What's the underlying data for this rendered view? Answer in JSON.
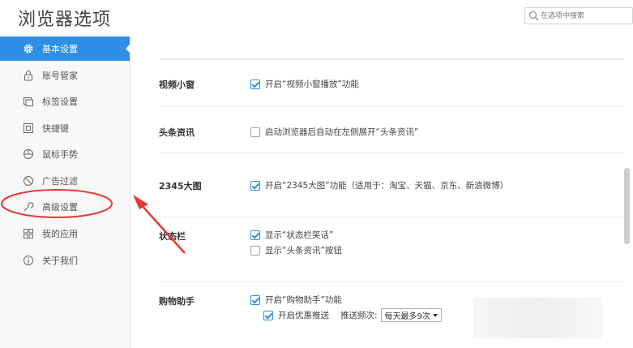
{
  "header": {
    "title": "浏览器选项",
    "search_placeholder": "在选项中搜索"
  },
  "sidebar": {
    "items": [
      {
        "label": "基本设置",
        "icon": "gear-icon",
        "active": true
      },
      {
        "label": "账号管家",
        "icon": "lock-icon"
      },
      {
        "label": "标签设置",
        "icon": "tabs-icon"
      },
      {
        "label": "快捷键",
        "icon": "key-icon"
      },
      {
        "label": "鼠标手势",
        "icon": "mouse-icon"
      },
      {
        "label": "广告过滤",
        "icon": "block-icon"
      },
      {
        "label": "高级设置",
        "icon": "wrench-icon"
      },
      {
        "label": "我的应用",
        "icon": "apps-icon"
      },
      {
        "label": "关于我们",
        "icon": "info-icon"
      }
    ]
  },
  "settings": {
    "video": {
      "label": "视频小窗",
      "option": "开启“视频小窗播放”功能",
      "checked": true
    },
    "news": {
      "label": "头条资讯",
      "option": "启动浏览器后自动在左侧展开“头条资讯”",
      "checked": false
    },
    "bigpic": {
      "label": "2345大图",
      "option": "开启“2345大图”功能（适用于：淘宝、天猫、京东、新浪微博）",
      "checked": true
    },
    "statusbar": {
      "label": "状态栏",
      "option1": "显示“状态栏笑话”",
      "option1_checked": true,
      "option2": "显示“头条资讯”按钮",
      "option2_checked": false
    },
    "shopping": {
      "label": "购物助手",
      "option1": "开启“购物助手”功能",
      "option1_checked": true,
      "option2": "开启优惠推送",
      "option2_checked": true,
      "freq_label": "推送频次:",
      "freq_value": "每天最多9次"
    }
  },
  "colors": {
    "accent": "#2e8fe6",
    "annotation": "#e53935"
  }
}
